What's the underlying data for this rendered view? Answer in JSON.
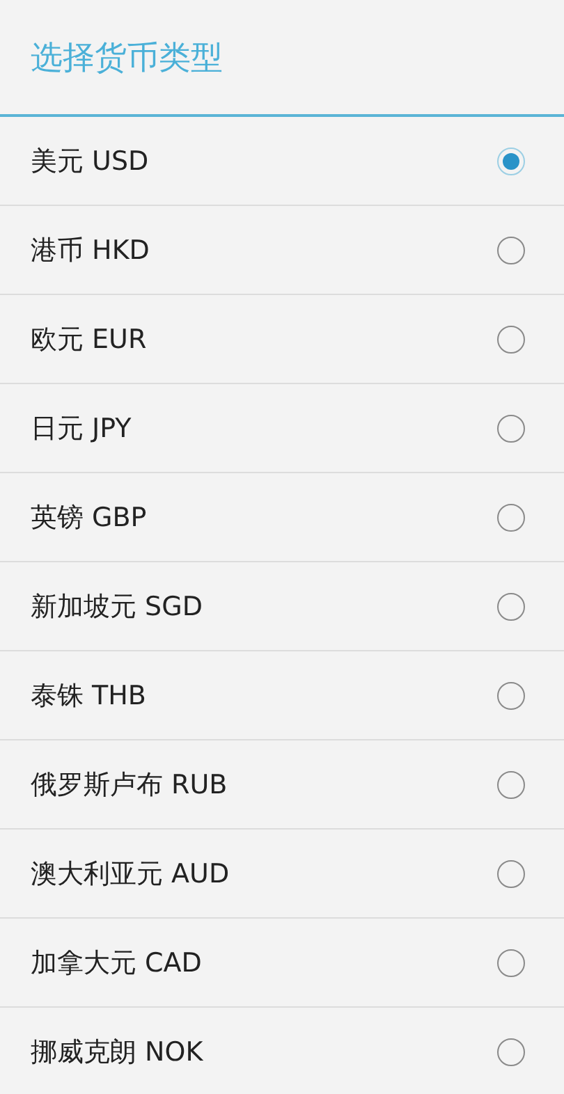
{
  "dialog": {
    "title": "选择货币类型"
  },
  "options": [
    {
      "label": "美元 USD",
      "selected": true
    },
    {
      "label": "港币 HKD",
      "selected": false
    },
    {
      "label": "欧元 EUR",
      "selected": false
    },
    {
      "label": "日元 JPY",
      "selected": false
    },
    {
      "label": "英镑 GBP",
      "selected": false
    },
    {
      "label": "新加坡元 SGD",
      "selected": false
    },
    {
      "label": "泰铢 THB",
      "selected": false
    },
    {
      "label": "俄罗斯卢布 RUB",
      "selected": false
    },
    {
      "label": "澳大利亚元 AUD",
      "selected": false
    },
    {
      "label": "加拿大元 CAD",
      "selected": false
    },
    {
      "label": "挪威克朗 NOK",
      "selected": false
    }
  ]
}
